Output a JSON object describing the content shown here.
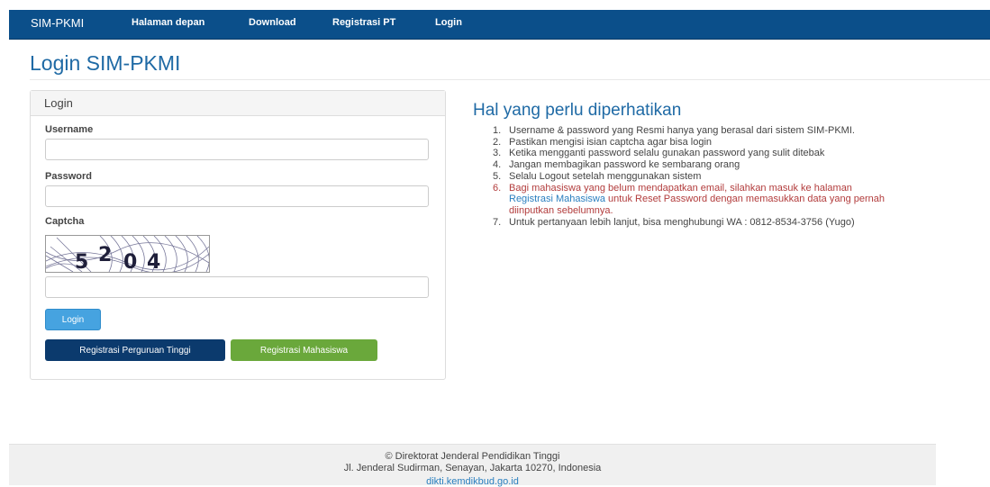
{
  "navbar": {
    "brand": "SIM-PKMI",
    "items": [
      "Halaman depan",
      "Download",
      "Registrasi PT",
      "Login"
    ]
  },
  "page": {
    "title": "Login SIM-PKMI"
  },
  "panel": {
    "heading": "Login",
    "username_label": "Username",
    "username_value": "",
    "password_label": "Password",
    "password_value": "",
    "captcha_label": "Captcha",
    "captcha_text": "5204",
    "captcha_value": "",
    "login_button": "Login",
    "reg_pt_button": "Registrasi Perguruan Tinggi",
    "reg_mhs_button": "Registrasi Mahasiswa"
  },
  "info": {
    "title": "Hal yang perlu diperhatikan",
    "items": [
      {
        "num": "1.",
        "text": "Username & password yang Resmi hanya yang berasal dari sistem SIM-PKMI."
      },
      {
        "num": "2.",
        "text": "Pastikan mengisi isian captcha agar bisa login"
      },
      {
        "num": "3.",
        "text": "Ketika mengganti password selalu gunakan password yang sulit ditebak"
      },
      {
        "num": "4.",
        "text": "Jangan membagikan password ke sembarang orang"
      },
      {
        "num": "5.",
        "text": "Selalu Logout setelah menggunakan sistem"
      },
      {
        "num": "6.",
        "before": "Bagi mahasiswa yang belum mendapatkan email, silahkan masuk ke halaman ",
        "link": "Registrasi Mahasiswa",
        "after": " untuk Reset Password dengan memasukkan data yang pernah diinputkan sebelumnya."
      },
      {
        "num": "7.",
        "text": "Untuk pertanyaan lebih lanjut, bisa menghubungi WA : 0812-8534-3756 (Yugo)"
      }
    ]
  },
  "footer": {
    "line1": "© Direktorat Jenderal Pendidikan Tinggi",
    "line2": "Jl. Jenderal Sudirman, Senayan, Jakarta 10270, Indonesia",
    "line3": "dikti.kemdikbud.go.id"
  },
  "colors": {
    "navbar": "#0b4f8a",
    "title": "#1f6aa5",
    "login_button": "#46a3e0",
    "reg_pt_button": "#0b3a6d",
    "reg_mhs_button": "#6aa83b",
    "warning_text": "#b23c3c",
    "link": "#2a7fbf"
  }
}
